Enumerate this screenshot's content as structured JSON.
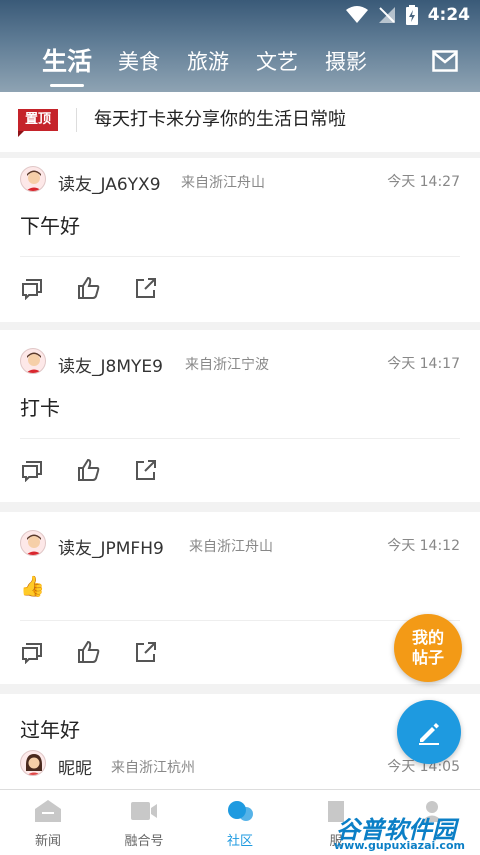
{
  "status": {
    "time": "4:24"
  },
  "tabs": [
    "生活",
    "美食",
    "旅游",
    "文艺",
    "摄影"
  ],
  "pinned": {
    "badge": "置顶",
    "text": "每天打卡来分享你的生活日常啦"
  },
  "posts": [
    {
      "user": "读友_JA6YX9",
      "location": "来自浙江舟山",
      "time": "今天 14:27",
      "content": "下午好"
    },
    {
      "user": "读友_J8MYE9",
      "location": "来自浙江宁波",
      "time": "今天 14:17",
      "content": "打卡"
    },
    {
      "user": "读友_JPMFH9",
      "location": "来自浙江舟山",
      "time": "今天 14:12",
      "content": "👍"
    },
    {
      "user": "昵昵",
      "location": "来自浙江杭州",
      "time": "今天 14:05",
      "content": "过年好"
    }
  ],
  "fab": {
    "my_posts": "我的帖子"
  },
  "nav": [
    "新闻",
    "融合号",
    "社区",
    "服"
  ],
  "watermark": {
    "title": "谷普软件园",
    "url": "www.gupuxiazai.com"
  },
  "colors": {
    "accent": "#1e9ae0",
    "orange": "#f39a16",
    "pin": "#c5232a"
  }
}
